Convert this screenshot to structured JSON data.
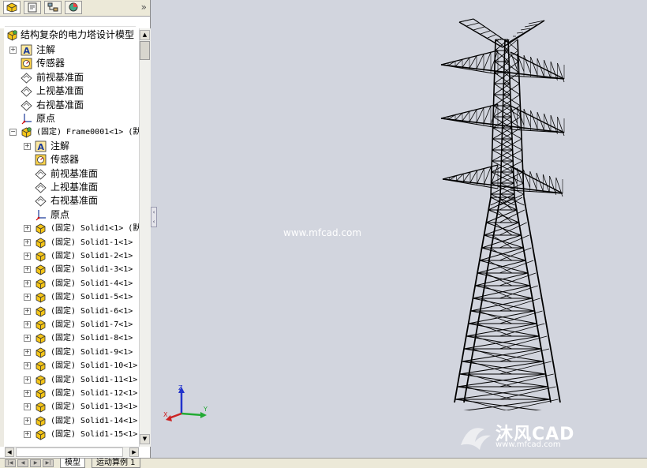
{
  "feature_tree": {
    "root_label": "结构复杂的电力塔设计模型",
    "items": [
      {
        "label": "注解",
        "icon": "annotation-icon",
        "indent": 1,
        "expandable": true
      },
      {
        "label": "传感器",
        "icon": "sensor-icon",
        "indent": 1,
        "expandable": false
      },
      {
        "label": "前视基准面",
        "icon": "plane-icon",
        "indent": 1,
        "expandable": false
      },
      {
        "label": "上视基准面",
        "icon": "plane-icon",
        "indent": 1,
        "expandable": false
      },
      {
        "label": "右视基准面",
        "icon": "plane-icon",
        "indent": 1,
        "expandable": false
      },
      {
        "label": "原点",
        "icon": "origin-icon",
        "indent": 1,
        "expandable": false
      },
      {
        "label": "(固定) Frame0001<1> (默",
        "icon": "assembly-icon",
        "indent": 1,
        "expandable": true,
        "expanded": true
      },
      {
        "label": "注解",
        "icon": "annotation-icon",
        "indent": 2,
        "expandable": true
      },
      {
        "label": "传感器",
        "icon": "sensor-icon",
        "indent": 2,
        "expandable": false
      },
      {
        "label": "前视基准面",
        "icon": "plane-icon",
        "indent": 2,
        "expandable": false
      },
      {
        "label": "上视基准面",
        "icon": "plane-icon",
        "indent": 2,
        "expandable": false
      },
      {
        "label": "右视基准面",
        "icon": "plane-icon",
        "indent": 2,
        "expandable": false
      },
      {
        "label": "原点",
        "icon": "origin-icon",
        "indent": 2,
        "expandable": false
      },
      {
        "label": "(固定) Solid1<1> (默",
        "icon": "part-icon",
        "indent": 2,
        "expandable": true
      },
      {
        "label": "(固定) Solid1-1<1>",
        "icon": "part-icon",
        "indent": 2,
        "expandable": true
      },
      {
        "label": "(固定) Solid1-2<1>",
        "icon": "part-icon",
        "indent": 2,
        "expandable": true
      },
      {
        "label": "(固定) Solid1-3<1>",
        "icon": "part-icon",
        "indent": 2,
        "expandable": true
      },
      {
        "label": "(固定) Solid1-4<1>",
        "icon": "part-icon",
        "indent": 2,
        "expandable": true
      },
      {
        "label": "(固定) Solid1-5<1>",
        "icon": "part-icon",
        "indent": 2,
        "expandable": true
      },
      {
        "label": "(固定) Solid1-6<1>",
        "icon": "part-icon",
        "indent": 2,
        "expandable": true
      },
      {
        "label": "(固定) Solid1-7<1>",
        "icon": "part-icon",
        "indent": 2,
        "expandable": true
      },
      {
        "label": "(固定) Solid1-8<1>",
        "icon": "part-icon",
        "indent": 2,
        "expandable": true
      },
      {
        "label": "(固定) Solid1-9<1>",
        "icon": "part-icon",
        "indent": 2,
        "expandable": true
      },
      {
        "label": "(固定) Solid1-10<1>",
        "icon": "part-icon",
        "indent": 2,
        "expandable": true
      },
      {
        "label": "(固定) Solid1-11<1>",
        "icon": "part-icon",
        "indent": 2,
        "expandable": true
      },
      {
        "label": "(固定) Solid1-12<1>",
        "icon": "part-icon",
        "indent": 2,
        "expandable": true
      },
      {
        "label": "(固定) Solid1-13<1>",
        "icon": "part-icon",
        "indent": 2,
        "expandable": true
      },
      {
        "label": "(固定) Solid1-14<1>",
        "icon": "part-icon",
        "indent": 2,
        "expandable": true
      },
      {
        "label": "(固定) Solid1-15<1>",
        "icon": "part-icon",
        "indent": 2,
        "expandable": true
      }
    ]
  },
  "top_tabs": [
    "feature-manager-icon",
    "property-manager-icon",
    "configuration-manager-icon",
    "display-manager-icon"
  ],
  "bottom_tabs": [
    "模型",
    "运动算例 1"
  ],
  "viewport": {
    "watermark": "www.mfcad.com",
    "logo_text": "沐风CAD",
    "logo_url": "www.mfcad.com",
    "triad": {
      "x": "X",
      "y": "Y",
      "z": "Z"
    }
  },
  "colors": {
    "viewport_bg": "#d2d5de",
    "tree_bg": "#ffffff",
    "tower": "#000000"
  }
}
